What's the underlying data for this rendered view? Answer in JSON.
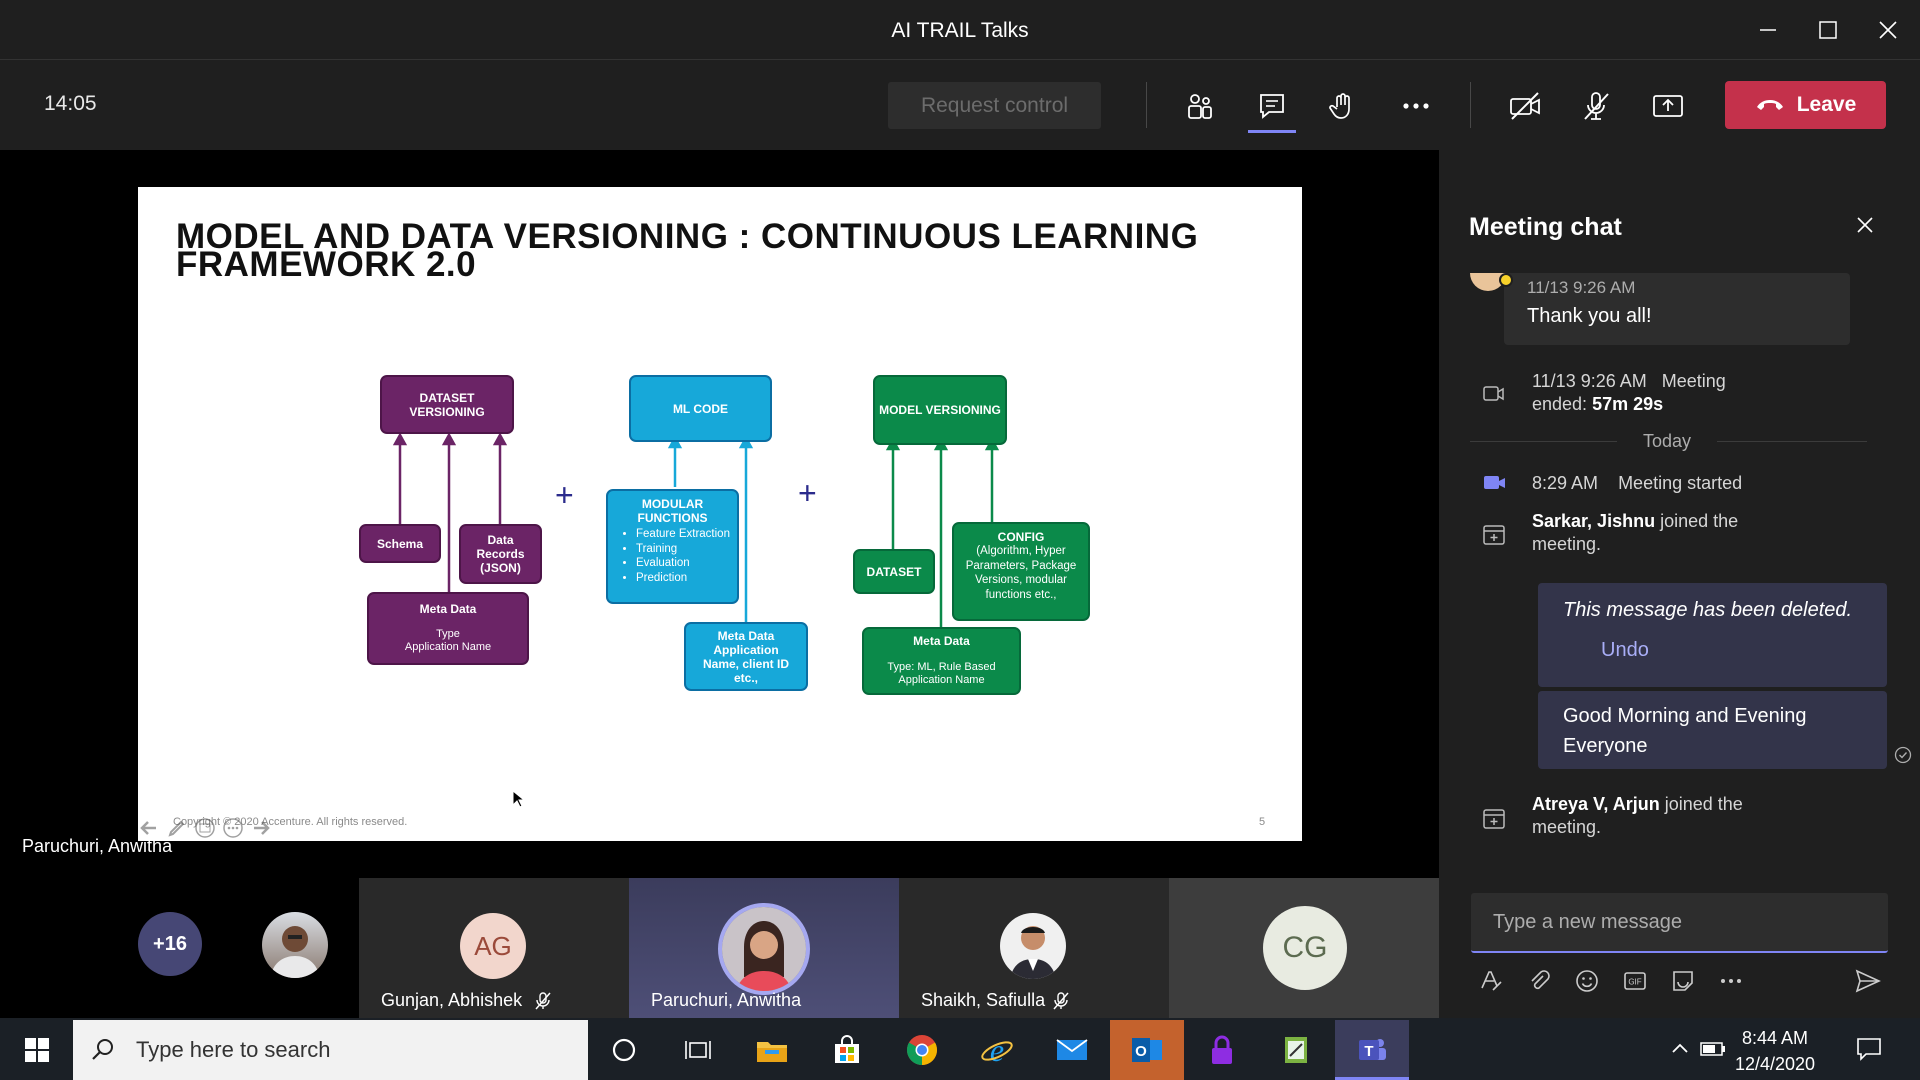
{
  "window": {
    "title": "AI TRAIL Talks"
  },
  "toolbar": {
    "time": "14:05",
    "request_control": "Request control",
    "leave_label": "Leave"
  },
  "slide": {
    "title": "MODEL AND DATA VERSIONING : CONTINUOUS LEARNING FRAMEWORK 2.0",
    "footer": "Copyright © 2020 Accenture. All rights reserved.",
    "page_number": "5",
    "boxes": {
      "dataset_versioning": "DATASET VERSIONING",
      "schema": "Schema",
      "data_records": "Data Records (JSON)",
      "meta_data_1_title": "Meta Data",
      "meta_data_1_body": "Type\nApplication Name",
      "ml_code": "ML CODE",
      "modular_title": "MODULAR FUNCTIONS",
      "modular_items": [
        "Feature Extraction",
        "Training",
        "Evaluation",
        "Prediction"
      ],
      "meta_data_2": "Meta Data Application Name, client ID etc.,",
      "model_versioning": "MODEL VERSIONING",
      "dataset": "DATASET",
      "config_title": "CONFIG",
      "config_body": "(Algorithm, Hyper Parameters, Package Versions, modular functions etc.,",
      "meta_data_3_title": "Meta Data",
      "meta_data_3_body": "Type: ML, Rule Based\nApplication Name"
    },
    "plus": "+"
  },
  "stage": {
    "presenter_label": "Paruchuri, Anwitha"
  },
  "participants": {
    "overflow_count": "+16",
    "tiles": [
      {
        "name": "Gunjan, Abhishek",
        "initials": "AG"
      },
      {
        "name": "Paruchuri, Anwitha"
      },
      {
        "name": "Shaikh, Safiulla"
      },
      {
        "initials": "CG"
      }
    ]
  },
  "chat": {
    "title": "Meeting chat",
    "messages": {
      "thanks_time": "11/13 9:26 AM",
      "thanks_text": "Thank you all!",
      "ended_time": "11/13 9:26 AM",
      "ended_text": "Meeting",
      "ended_text2": "ended:",
      "ended_duration": "57m 29s",
      "today": "Today",
      "started_time": "8:29 AM",
      "started_text": "Meeting started",
      "joined1_name": "Sarkar, Jishnu",
      "joined1_text": "joined the",
      "joined1_text2": "meeting.",
      "deleted_text": "This message has been deleted.",
      "undo": "Undo",
      "good_morning": "Good Morning and Evening",
      "good_morning2": "Everyone",
      "joined2_name": "Atreya V, Arjun",
      "joined2_text": "joined the",
      "joined2_text2": "meeting."
    },
    "input_placeholder": "Type a new message"
  },
  "taskbar": {
    "search_placeholder": "Type here to search",
    "time": "8:44 AM",
    "date": "12/4/2020"
  },
  "colors": {
    "leave": "#c4314b",
    "accent": "#7f85f5",
    "purple": "#6b2466",
    "blue": "#17a8d9",
    "green": "#0b8a4a"
  }
}
